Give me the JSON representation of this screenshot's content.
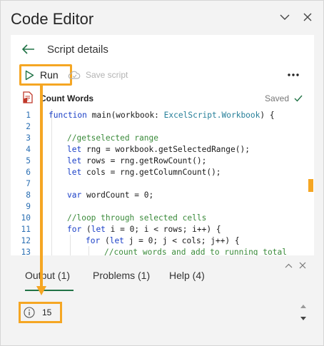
{
  "header": {
    "title": "Code Editor",
    "icons": [
      "chevron-down-icon",
      "close-icon"
    ]
  },
  "nav": {
    "back_icon": "back-arrow-icon",
    "title": "Script details"
  },
  "toolbar": {
    "run_label": "Run",
    "save_label": "Save script",
    "more_icon": "more-icon"
  },
  "script": {
    "name": "Count Words",
    "status": "Saved"
  },
  "editor": {
    "lines": [
      {
        "n": "1",
        "text": "function main(workbook: ExcelScript.Workbook) {"
      },
      {
        "n": "2",
        "text": ""
      },
      {
        "n": "3",
        "text": "//getselected range"
      },
      {
        "n": "4",
        "text": "let rng = workbook.getSelectedRange();"
      },
      {
        "n": "5",
        "text": "let rows = rng.getRowCount();"
      },
      {
        "n": "6",
        "text": "let cols = rng.getColumnCount();"
      },
      {
        "n": "7",
        "text": ""
      },
      {
        "n": "8",
        "text": "var wordCount = 0;"
      },
      {
        "n": "9",
        "text": ""
      },
      {
        "n": "10",
        "text": "//loop through selected cells"
      },
      {
        "n": "11",
        "text": "for (let i = 0; i < rows; i++) {"
      },
      {
        "n": "12",
        "text": "for (let j = 0; j < cols; j++) {"
      },
      {
        "n": "13",
        "text": "//count words and add to running total"
      }
    ]
  },
  "bottom_panel": {
    "tabs": [
      {
        "label": "Output (1)",
        "active": true
      },
      {
        "label": "Problems (1)",
        "active": false
      },
      {
        "label": "Help (4)",
        "active": false
      }
    ],
    "output_value": "15",
    "info_icon": "info-icon"
  },
  "colors": {
    "highlight": "#f5a623",
    "run_green": "#217346",
    "keyword": "#1a3fc7",
    "comment": "#3a8a3a",
    "type": "#267f99",
    "line_number": "#2b6fb3"
  }
}
